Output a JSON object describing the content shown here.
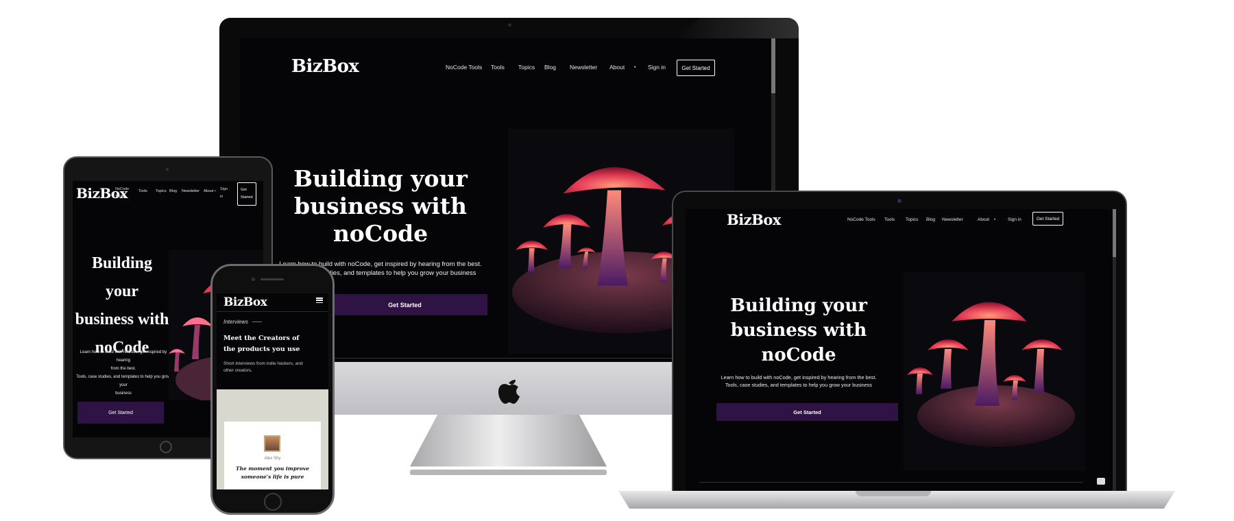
{
  "site": {
    "logo": "BizBox",
    "nav": [
      "NoCode Tools",
      "Tools",
      "Topics",
      "Blog",
      "Newsletter",
      "About",
      "•",
      "Sign in"
    ],
    "cta_button": "Get Started"
  },
  "hero": {
    "title_line1": "Building your",
    "title_line2": "business with",
    "title_line3": "noCode",
    "text_line1": "Learn how to build with noCode, get inspired by hearing from the best.",
    "text_line2": "Tools, case studies, and templates to help you grow your business",
    "button": "Get Started"
  },
  "tablet": {
    "nav_nocode_1": "NoCode",
    "nav_nocode_2": "Tools",
    "nav_items": [
      "Tools",
      "Topics",
      "Blog",
      "Newsletter",
      "About",
      "•"
    ],
    "sign_1": "Sign",
    "sign_2": "in",
    "cta_1": "Get",
    "cta_2": "Started",
    "text_line1": "Learn how to build with noCode, get inspired by hearing",
    "text_line2": "from the best.",
    "text_line3": "Tools, case studies, and templates to help you grow your",
    "text_line4": "business"
  },
  "phone": {
    "menu_icon": "hamburger-menu-icon",
    "section_label": "Interviews",
    "section_title_line1": "Meet the Creators of",
    "section_title_line2": "the products you use",
    "section_text_line1": "Short interviews from indie hackers, and",
    "section_text_line2": "other creators.",
    "card_author": "Alex Shy",
    "card_quote_line1": "The moment you improve",
    "card_quote_line2": "someone's life is pure"
  },
  "icons": {
    "apple": "apple-logo-icon",
    "camera": "camera-icon",
    "home": "home-button-icon"
  },
  "colors": {
    "page_bg": "#ffffff",
    "screen_bg": "#050507",
    "button_purple": "#2f1344",
    "mushroom_red": "#e23a55",
    "mushroom_pink": "#ff6f8e",
    "mound_purple": "#4a2536"
  }
}
